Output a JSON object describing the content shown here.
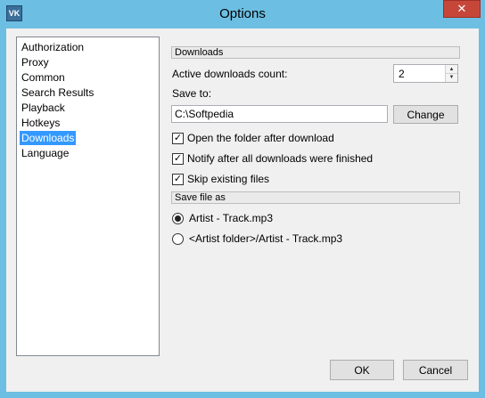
{
  "window": {
    "title": "Options",
    "close_glyph": "✕",
    "icon_text": "VK"
  },
  "nav": {
    "items": [
      {
        "label": "Authorization",
        "selected": false
      },
      {
        "label": "Proxy",
        "selected": false
      },
      {
        "label": "Common",
        "selected": false
      },
      {
        "label": "Search Results",
        "selected": false
      },
      {
        "label": "Playback",
        "selected": false
      },
      {
        "label": "Hotkeys",
        "selected": false
      },
      {
        "label": "Downloads",
        "selected": true
      },
      {
        "label": "Language",
        "selected": false
      }
    ]
  },
  "downloads": {
    "header": "Downloads",
    "count_label": "Active downloads count:",
    "count_value": "2",
    "save_to_label": "Save to:",
    "path_value": "C:\\Softpedia",
    "change_button": "Change",
    "options": [
      {
        "label": "Open the folder after download",
        "checked": true
      },
      {
        "label": "Notify after all downloads were finished",
        "checked": true
      },
      {
        "label": "Skip existing files",
        "checked": true
      }
    ]
  },
  "save_file_as": {
    "header": "Save file as",
    "options": [
      {
        "label": "Artist - Track.mp3",
        "selected": true
      },
      {
        "label": "<Artist folder>/Artist - Track.mp3",
        "selected": false
      }
    ]
  },
  "footer": {
    "ok_label": "OK",
    "cancel_label": "Cancel"
  },
  "icons": {
    "check": "✓",
    "spin_up": "▲",
    "spin_down": "▼"
  }
}
